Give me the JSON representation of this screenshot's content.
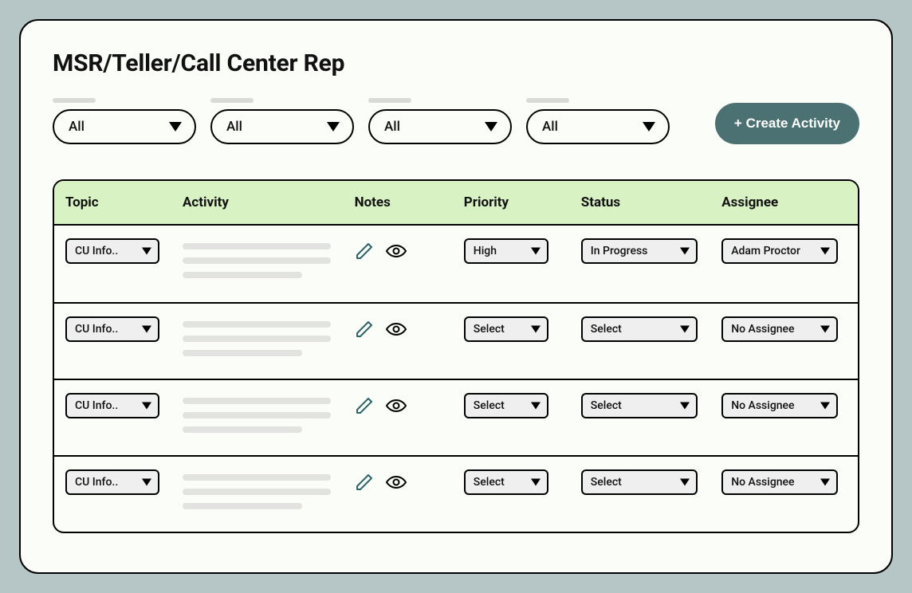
{
  "page": {
    "title": "MSR/Teller/Call Center Rep"
  },
  "filters": {
    "items": [
      {
        "value": "All"
      },
      {
        "value": "All"
      },
      {
        "value": "All"
      },
      {
        "value": "All"
      }
    ]
  },
  "actions": {
    "create_label": "+ Create Activity"
  },
  "table": {
    "headers": {
      "topic": "Topic",
      "activity": "Activity",
      "notes": "Notes",
      "priority": "Priority",
      "status": "Status",
      "assignee": "Assignee"
    },
    "rows": [
      {
        "topic": "CU Info..",
        "priority": "High",
        "status": "In Progress",
        "assignee": "Adam Proctor"
      },
      {
        "topic": "CU Info..",
        "priority": "Select",
        "status": "Select",
        "assignee": "No Assignee"
      },
      {
        "topic": "CU Info..",
        "priority": "Select",
        "status": "Select",
        "assignee": "No Assignee"
      },
      {
        "topic": "CU Info..",
        "priority": "Select",
        "status": "Select",
        "assignee": "No Assignee"
      }
    ]
  },
  "colors": {
    "accent": "#4C7173",
    "header_bg": "#D8F2C4"
  }
}
